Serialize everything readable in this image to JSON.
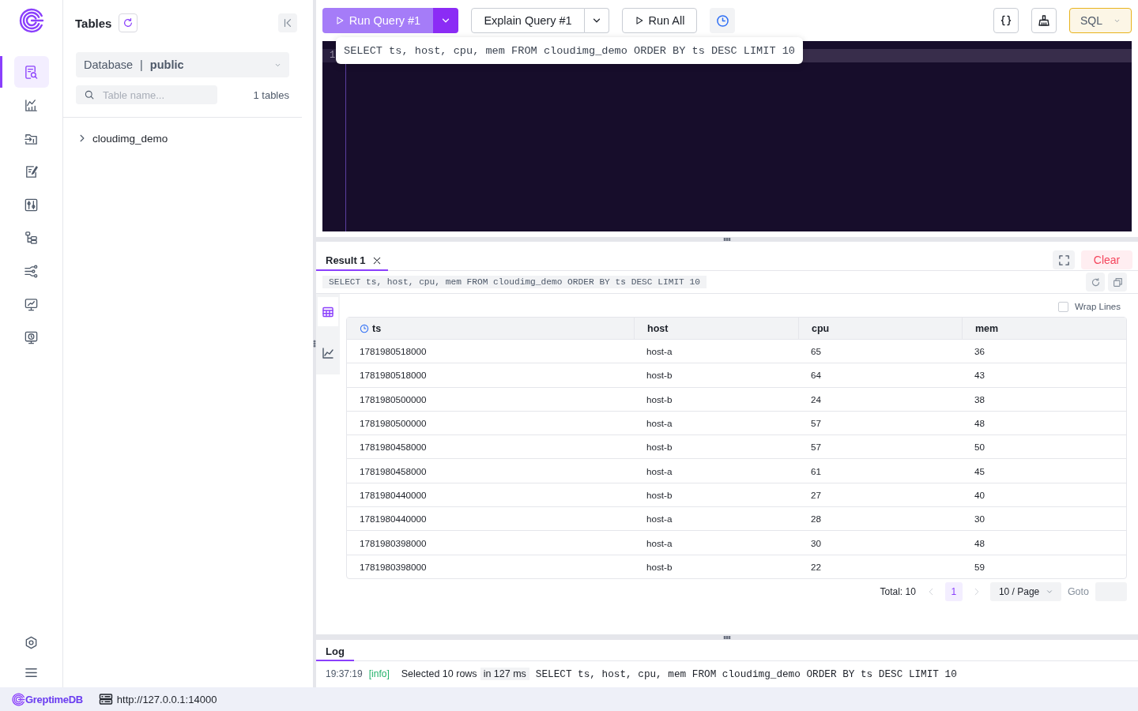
{
  "nav": {
    "items": [
      {
        "kind": "query",
        "selected": true
      },
      {
        "kind": "dashboard",
        "selected": false
      },
      {
        "kind": "ingest",
        "selected": false
      },
      {
        "kind": "scripts",
        "selected": false
      },
      {
        "kind": "sliders",
        "selected": false
      },
      {
        "kind": "hierarchy",
        "selected": false
      },
      {
        "kind": "pipeline",
        "selected": false
      },
      {
        "kind": "monitor_chart",
        "selected": false
      },
      {
        "kind": "monitor_clock",
        "selected": false
      }
    ],
    "bottom_items": [
      {
        "kind": "settings"
      },
      {
        "kind": "menu"
      }
    ]
  },
  "tables_panel": {
    "title": "Tables",
    "database": {
      "label": "Database",
      "separator": "|",
      "value": "public"
    },
    "search": {
      "placeholder": "Table name..."
    },
    "count": "1 tables",
    "tree": [
      {
        "label": "cloudimg_demo",
        "expanded": false
      }
    ]
  },
  "toolbar": {
    "run_button": "Run Query #1",
    "explain_button": "Explain Query #1",
    "run_all_button": "Run All",
    "language": "SQL"
  },
  "editor": {
    "line_numbers": [
      "1"
    ],
    "tooltip": "SELECT ts, host, cpu, mem FROM cloudimg_demo ORDER BY ts DESC LIMIT 10"
  },
  "results": {
    "tabs": [
      {
        "label": "Result 1",
        "selected": true
      }
    ],
    "clear_button": "Clear",
    "query": "SELECT ts, host, cpu, mem FROM cloudimg_demo ORDER BY ts DESC LIMIT 10",
    "views": [
      {
        "kind": "table",
        "selected": true
      },
      {
        "kind": "chart",
        "selected": false
      }
    ],
    "wrap_lines": {
      "label": "Wrap Lines",
      "checked": false
    },
    "table": {
      "columns": [
        {
          "label": "ts",
          "kind": "time"
        },
        {
          "label": "host",
          "kind": "text"
        },
        {
          "label": "cpu",
          "kind": "text"
        },
        {
          "label": "mem",
          "kind": "text"
        }
      ],
      "rows": [
        [
          "1781980518000",
          "host-a",
          "65",
          "36"
        ],
        [
          "1781980518000",
          "host-b",
          "64",
          "43"
        ],
        [
          "1781980500000",
          "host-b",
          "24",
          "38"
        ],
        [
          "1781980500000",
          "host-a",
          "57",
          "48"
        ],
        [
          "1781980458000",
          "host-b",
          "57",
          "50"
        ],
        [
          "1781980458000",
          "host-a",
          "61",
          "45"
        ],
        [
          "1781980440000",
          "host-b",
          "27",
          "40"
        ],
        [
          "1781980440000",
          "host-a",
          "28",
          "30"
        ],
        [
          "1781980398000",
          "host-a",
          "30",
          "48"
        ],
        [
          "1781980398000",
          "host-b",
          "22",
          "59"
        ]
      ]
    },
    "pagination": {
      "total": "Total: 10",
      "pages": [
        {
          "label": "1",
          "selected": true
        }
      ],
      "page_size": "10 / Page",
      "goto": "Goto"
    }
  },
  "log": {
    "tabs": [
      {
        "label": "Log",
        "selected": true
      }
    ],
    "entries": [
      {
        "time": "19:37:19",
        "level": "[info]",
        "message": "Selected 10 rows",
        "duration": "in 127 ms",
        "query": "SELECT ts, host, cpu, mem FROM cloudimg_demo ORDER BY ts DESC LIMIT 10"
      }
    ]
  },
  "status_bar": {
    "brand": "GreptimeDB",
    "url": "http://127.0.0.1:14000"
  }
}
